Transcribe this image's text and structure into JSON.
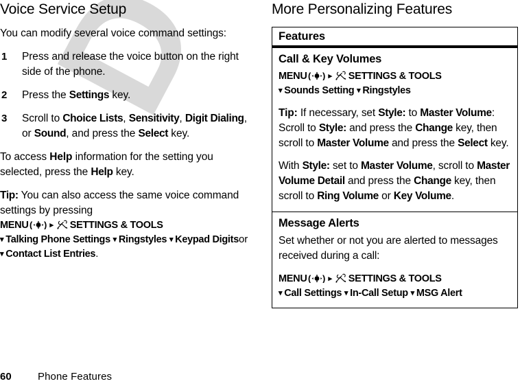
{
  "document": {
    "watermark": "DRAFT"
  },
  "left_column": {
    "title": "Voice Service Setup",
    "intro": "You can modify several voice command settings:",
    "steps": [
      {
        "num": "1",
        "parts": [
          {
            "t": "Press and release the voice button on the right side of the phone.",
            "b": false
          }
        ]
      },
      {
        "num": "2",
        "parts": [
          {
            "t": "Press the ",
            "b": false
          },
          {
            "t": "Settings",
            "b": true
          },
          {
            "t": " key.",
            "b": false
          }
        ]
      },
      {
        "num": "3",
        "parts": [
          {
            "t": "Scroll to ",
            "b": false
          },
          {
            "t": "Choice Lists",
            "b": true
          },
          {
            "t": ", ",
            "b": false
          },
          {
            "t": "Sensitivity",
            "b": true
          },
          {
            "t": ", ",
            "b": false
          },
          {
            "t": "Digit Dialing",
            "b": true
          },
          {
            "t": ", or ",
            "b": false
          },
          {
            "t": "Sound",
            "b": true
          },
          {
            "t": ", and press the ",
            "b": false
          },
          {
            "t": "Select",
            "b": true
          },
          {
            "t": " key.",
            "b": false
          }
        ]
      }
    ],
    "help_para": [
      {
        "t": "To access ",
        "b": false
      },
      {
        "t": "Help",
        "b": "wide"
      },
      {
        "t": " information for the setting you selected, press the ",
        "b": false
      },
      {
        "t": "Help",
        "b": true
      },
      {
        "t": " key.",
        "b": false
      }
    ],
    "tip_label": "Tip:",
    "tip_text": " You can also access the same voice command settings by pressing",
    "nav": {
      "menu_label": "MENU",
      "menu_key_icon": "five-way-navigation-key-icon",
      "arrow_right": "▸",
      "tools_icon": "settings-tools-icon",
      "settings_label": "SETTINGS & TOOLS",
      "arrow_down": "▾",
      "items": [
        "Talking Phone Settings",
        "Ringstyles",
        "Keypad Digits"
      ],
      "trailing_or": "or",
      "items_line2": [
        "Contact List Entries"
      ],
      "trailing_period": "."
    }
  },
  "right_column": {
    "title": "More Personalizing Features",
    "table": {
      "header": "Features",
      "rows": [
        {
          "title": "Call & Key Volumes",
          "nav": {
            "menu_label": "MENU",
            "arrow_right": "▸",
            "settings_label": "SETTINGS & TOOLS",
            "arrow_down": "▾",
            "items": [
              "Sounds Setting",
              "Ringstyles"
            ]
          },
          "paragraphs": [
            [
              {
                "t": "Tip:",
                "b": "wide"
              },
              {
                "t": " If necessary, set ",
                "b": false
              },
              {
                "t": "Style:",
                "b": true
              },
              {
                "t": " to ",
                "b": false
              },
              {
                "t": "Master Volume",
                "b": true
              },
              {
                "t": ": Scroll to ",
                "b": false
              },
              {
                "t": "Style:",
                "b": true
              },
              {
                "t": " and press the ",
                "b": false
              },
              {
                "t": "Change",
                "b": true
              },
              {
                "t": " key, then scroll to ",
                "b": false
              },
              {
                "t": "Master Volume",
                "b": true
              },
              {
                "t": " and press the ",
                "b": false
              },
              {
                "t": "Select",
                "b": true
              },
              {
                "t": " key.",
                "b": false
              }
            ],
            [
              {
                "t": "With ",
                "b": false
              },
              {
                "t": "Style:",
                "b": true
              },
              {
                "t": " set to ",
                "b": false
              },
              {
                "t": "Master Volume",
                "b": true
              },
              {
                "t": ", scroll to ",
                "b": false
              },
              {
                "t": "Master Volume Detail",
                "b": true
              },
              {
                "t": " and press the ",
                "b": false
              },
              {
                "t": "Change",
                "b": true
              },
              {
                "t": " key, then scroll to ",
                "b": false
              },
              {
                "t": "Ring Volume",
                "b": true
              },
              {
                "t": " or ",
                "b": false
              },
              {
                "t": "Key Volume",
                "b": true
              },
              {
                "t": ".",
                "b": false
              }
            ]
          ]
        },
        {
          "title": "Message Alerts",
          "intro": "Set whether or not you are alerted to messages received during a call:",
          "nav": {
            "menu_label": "MENU",
            "arrow_right": "▸",
            "settings_label": "SETTINGS & TOOLS",
            "arrow_down": "▾",
            "items": [
              "Call Settings",
              "In-Call Setup",
              "MSG Alert"
            ]
          }
        }
      ]
    }
  },
  "footer": {
    "page_number": "60",
    "section_label": "Phone Features"
  }
}
